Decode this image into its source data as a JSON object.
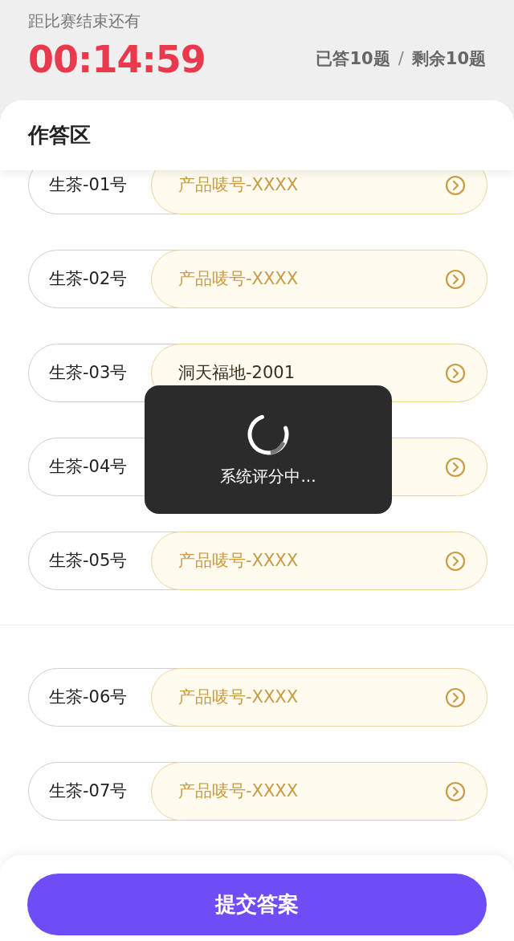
{
  "header": {
    "label": "距比赛结束还有",
    "timer": "00:14:59",
    "answered": "已答10题",
    "separator": "/",
    "remaining": "剩余10题"
  },
  "answer_area": {
    "title": "作答区",
    "groups": [
      {
        "rows": [
          {
            "label": "生茶-01号",
            "answer": "产品唛号-XXXX",
            "filled": false
          },
          {
            "label": "生茶-02号",
            "answer": "产品唛号-XXXX",
            "filled": false
          },
          {
            "label": "生茶-03号",
            "answer": "洞天福地-2001",
            "filled": true
          },
          {
            "label": "生茶-04号"
          },
          {
            "label": "生茶-05号",
            "answer": "产品唛号-XXXX",
            "filled": false
          }
        ]
      },
      {
        "rows": [
          {
            "label": "生茶-06号",
            "answer": "产品唛号-XXXX",
            "filled": false
          },
          {
            "label": "生茶-07号",
            "answer": "产品唛号-XXXX",
            "filled": false
          }
        ]
      }
    ]
  },
  "toast": {
    "text": "系统评分中..."
  },
  "submit_button": {
    "label": "提交答案"
  }
}
